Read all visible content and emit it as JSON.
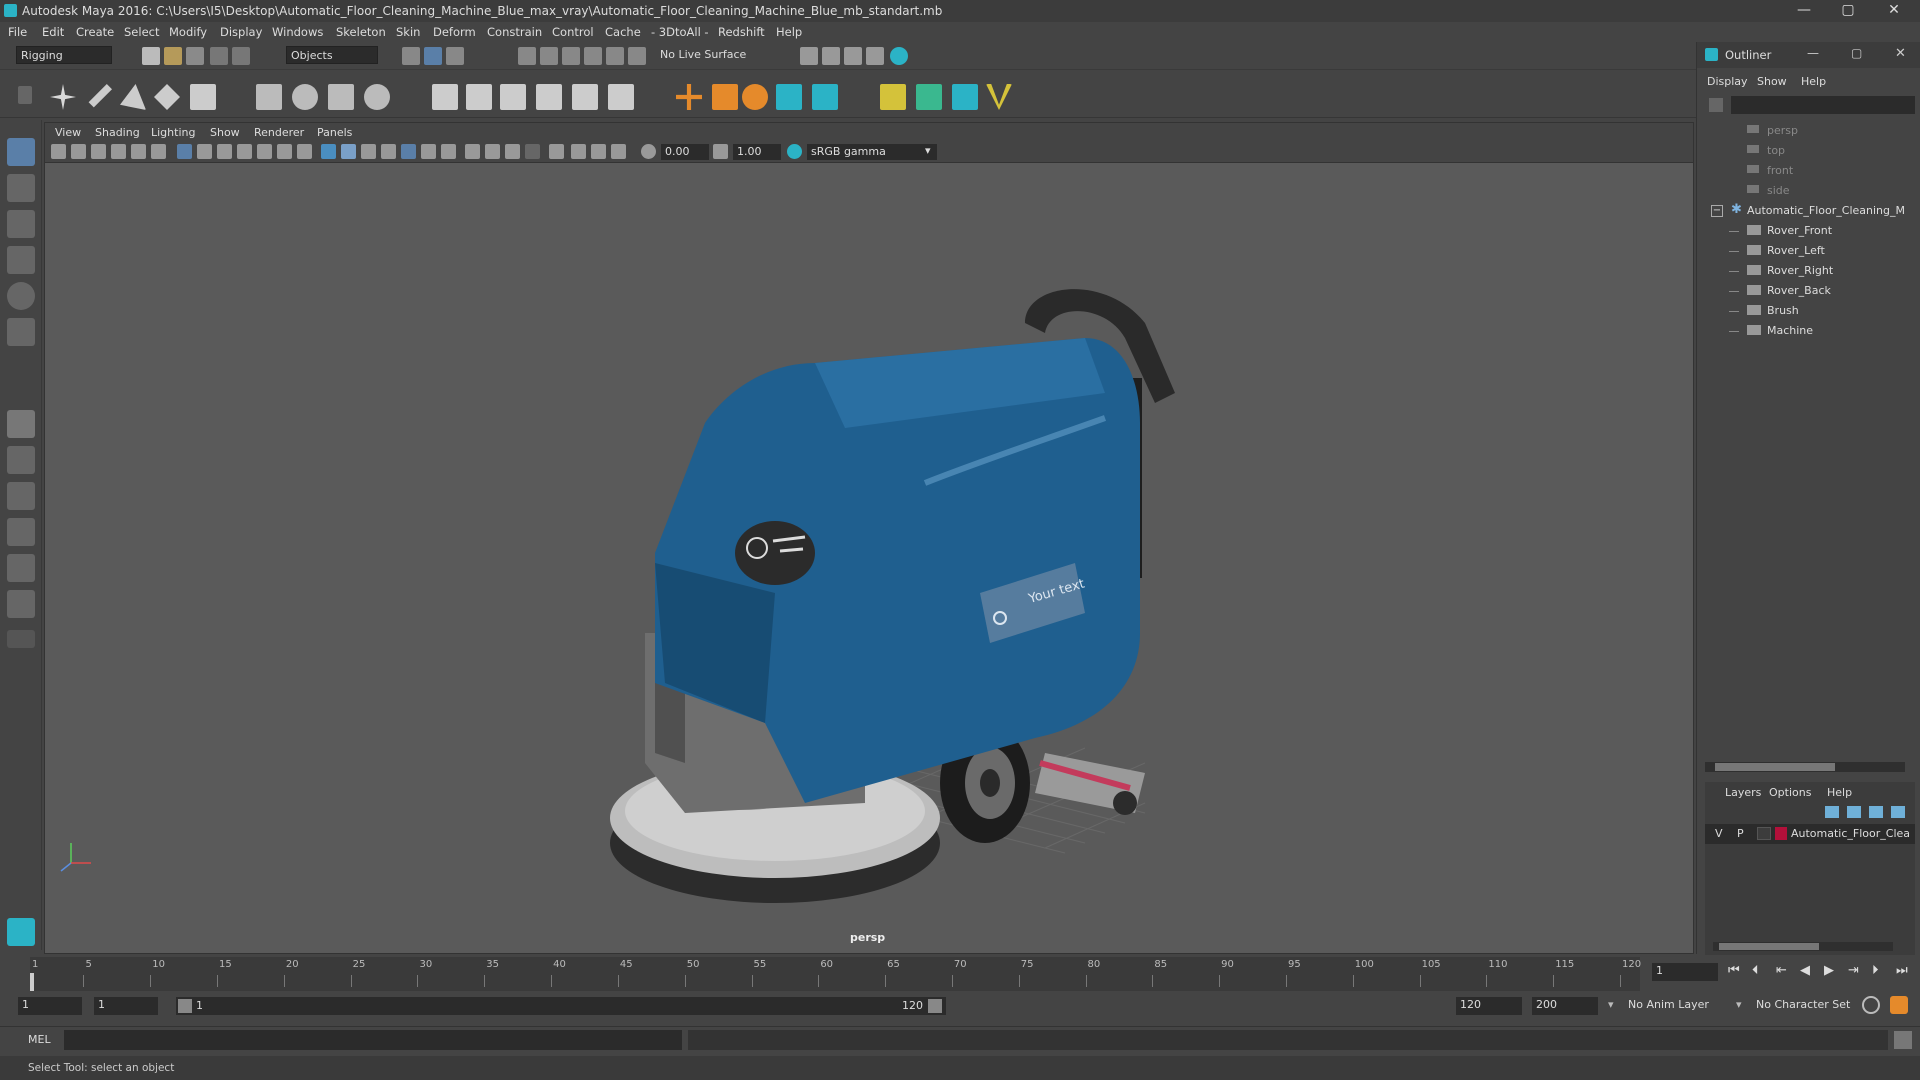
{
  "window": {
    "title": "Autodesk Maya 2016: C:\\Users\\I5\\Desktop\\Automatic_Floor_Cleaning_Machine_Blue_max_vray\\Automatic_Floor_Cleaning_Machine_Blue_mb_standart.mb",
    "minimize": "—",
    "maximize": "▢",
    "close": "✕"
  },
  "menus": [
    "File",
    "Edit",
    "Create",
    "Select",
    "Modify",
    "Display",
    "Windows",
    "Skeleton",
    "Skin",
    "Deform",
    "Constrain",
    "Control",
    "Cache",
    "- 3DtoAll -",
    "Redshift",
    "Help"
  ],
  "statusline": {
    "mode": "Rigging",
    "selection_mode": "Objects",
    "live_surface": "No Live Surface"
  },
  "viewport": {
    "menus": [
      "View",
      "Shading",
      "Lighting",
      "Show",
      "Renderer",
      "Panels"
    ],
    "exposure": "0.00",
    "gamma": "1.00",
    "color_space": "sRGB gamma",
    "camera_label": "persp",
    "decal_text": "Your text"
  },
  "outliner": {
    "title": "Outliner",
    "menus": [
      "Display",
      "Show",
      "Help"
    ],
    "cameras": [
      "persp",
      "top",
      "front",
      "side"
    ],
    "root": "Automatic_Floor_Cleaning_M",
    "children": [
      "Rover_Front",
      "Rover_Left",
      "Rover_Right",
      "Rover_Back",
      "Brush",
      "Machine"
    ],
    "layers_menus": [
      "Layers",
      "Options",
      "Help"
    ],
    "layer": {
      "v": "V",
      "p": "P",
      "name": "Automatic_Floor_Clear",
      "color": "#b3103a"
    }
  },
  "timeline": {
    "ticks": [
      "1",
      "5",
      "10",
      "15",
      "20",
      "25",
      "30",
      "35",
      "40",
      "45",
      "50",
      "55",
      "60",
      "65",
      "70",
      "75",
      "80",
      "85",
      "90",
      "95",
      "100",
      "105",
      "110",
      "115",
      "120"
    ],
    "current_frame": "1"
  },
  "range": {
    "start": "1",
    "playback_start": "1",
    "slider_start": "1",
    "slider_end": "120",
    "playback_end": "120",
    "end": "200",
    "anim_layer": "No Anim Layer",
    "char_set": "No Character Set"
  },
  "cmdline": {
    "lang": "MEL"
  },
  "helpline": {
    "text": "Select Tool: select an object"
  },
  "colors": {
    "accent": "#2bb3c6",
    "machine_blue": "#1f5f8f"
  }
}
